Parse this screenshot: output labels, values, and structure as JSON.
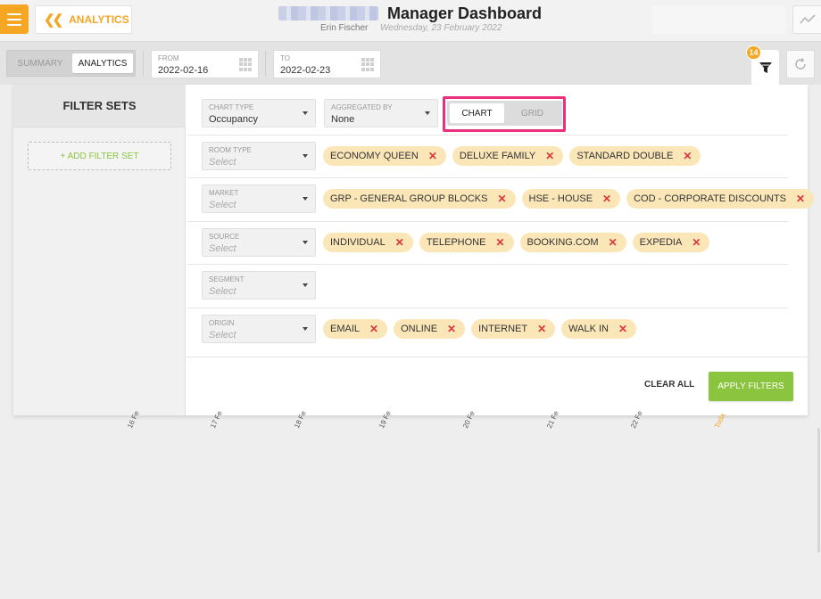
{
  "header": {
    "back_label": "ANALYTICS",
    "title": "Manager Dashboard",
    "user": "Erin Fischer",
    "date": "Wednesday, 23 February 2022"
  },
  "toolbar": {
    "tabs": [
      "SUMMARY",
      "ANALYTICS"
    ],
    "active_tab": "ANALYTICS",
    "from_label": "FROM",
    "from_value": "2022-02-16",
    "to_label": "TO",
    "to_value": "2022-02-23",
    "filter_count": "14"
  },
  "filter_sets": {
    "title": "FILTER SETS",
    "add_label": "+ ADD FILTER SET"
  },
  "filters": {
    "chart_type": {
      "label": "CHART TYPE",
      "value": "Occupancy"
    },
    "aggregated_by": {
      "label": "AGGREGATED BY",
      "value": "None"
    },
    "view_toggle": {
      "options": [
        "CHART",
        "GRID"
      ],
      "selected": "CHART"
    },
    "rows": [
      {
        "label": "ROOM TYPE",
        "placeholder": "Select",
        "chips": [
          "ECONOMY QUEEN",
          "DELUXE FAMILY",
          "STANDARD DOUBLE"
        ]
      },
      {
        "label": "MARKET",
        "placeholder": "Select",
        "chips": [
          "GRP - GENERAL GROUP BLOCKS",
          "HSE - HOUSE",
          "COD - CORPORATE DISCOUNTS"
        ]
      },
      {
        "label": "SOURCE",
        "placeholder": "Select",
        "chips": [
          "INDIVIDUAL",
          "TELEPHONE",
          "BOOKING.COM",
          "EXPEDIA"
        ]
      },
      {
        "label": "SEGMENT",
        "placeholder": "Select",
        "chips": []
      },
      {
        "label": "ORIGIN",
        "placeholder": "Select",
        "chips": [
          "EMAIL",
          "ONLINE",
          "INTERNET",
          "WALK IN"
        ]
      }
    ],
    "clear_label": "CLEAR ALL",
    "apply_label": "APPLY FILTERS"
  },
  "axis_ticks": [
    "16 Fe",
    "17 Fe",
    "18 Fe",
    "19 Fe",
    "20 Fe",
    "21 Fe",
    "22 Fe",
    "Toda"
  ],
  "colors": {
    "accent": "#f5a623",
    "apply": "#8bc53f",
    "chip": "#fbe6b8",
    "highlight": "#ec2f7d",
    "remove": "#d9363e"
  },
  "icons": {
    "menu": "hamburger-icon",
    "back": "double-chevron-left-icon",
    "trend": "trend-line-icon",
    "calendar": "calendar-grid-icon",
    "filter": "funnel-icon",
    "refresh": "refresh-icon",
    "remove": "close-x-icon"
  }
}
